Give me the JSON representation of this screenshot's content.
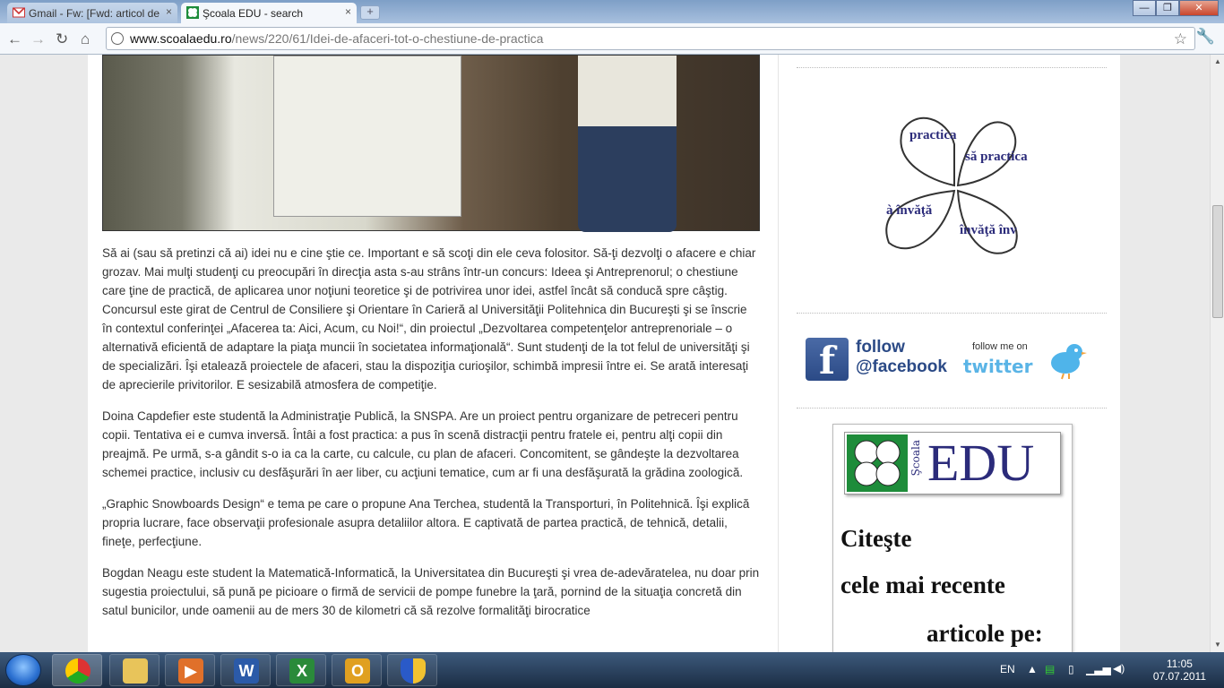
{
  "browser": {
    "tabs": [
      {
        "title": "Gmail - Fw: [Fwd: articol de",
        "active": false
      },
      {
        "title": "Şcoala EDU - search",
        "active": true
      }
    ],
    "close_tab": "×",
    "new_tab": "+",
    "url_host": "www.scoalaedu.ro",
    "url_path": "/news/220/61/Idei-de-afaceri-tot-o-chestiune-de-practica"
  },
  "article": {
    "paragraphs": [
      "Să ai (sau să pretinzi că ai) idei nu e cine ştie ce. Important e să scoţi din ele ceva folositor. Să-ţi dezvolţi o afacere e chiar grozav. Mai mulţi studenţi cu preocupări în direcţia asta s-au strâns într-un concurs: Ideea şi Antreprenorul; o chestiune care ţine de practică, de aplicarea unor noţiuni teoretice şi de potrivirea unor idei, astfel încât să conducă spre câştig. Concursul este girat de Centrul de Consiliere şi Orientare în Carieră al Universităţii Politehnica din Bucureşti şi se înscrie în contextul conferinţei „Afacerea ta: Aici, Acum, cu Noi!“, din proiectul „Dezvoltarea competenţelor antreprenoriale – o alternativă eficientă de adaptare la piaţa muncii în societatea informaţională“. Sunt studenţi de la tot felul de universităţi şi de specializări. Îşi etalează proiectele de afaceri, stau la dispoziţia curioşilor, schimbă impresii între ei. Se arată interesaţi de aprecierile privitorilor. E sesizabilă atmosfera de competiţie.",
      "Doina Capdefier este studentă la Administraţie Publică, la SNSPA. Are un proiect pentru organizare de petreceri pentru copii. Tentativa ei e cumva inversă. Întâi a fost practica: a pus în scenă distracţii pentru fratele ei, pentru alţi copii din preajmă. Pe urmă, s-a gândit s-o ia ca la carte, cu calcule, cu plan de afaceri. Concomitent, se gândeşte la dezvoltarea schemei practice, inclusiv cu desfăşurări în aer liber, cu acţiuni tematice, cum ar fi una desfăşurată la grădina zoologică.",
      "„Graphic Snowboards Design“ e tema pe care o propune Ana Terchea, studentă la Transporturi, în Politehnică. Îşi explică propria lucrare, face observaţii profesionale asupra detaliilor altora. E captivată de partea practică, de tehnică, detalii, fineţe, perfecţiune.",
      "Bogdan Neagu este student la Matematică-Informatică, la Universitatea din Bucureşti şi vrea de-adevăratelea, nu doar prin sugestia proiectului, să pună pe picioare o firmă de servicii de pompe funebre la ţară, pornind de la situaţia concretă din satul bunicilor, unde oamenii au de mers 30 de kilometri că să rezolve formalităţi birocratice"
    ]
  },
  "sidebar": {
    "clover_words": [
      "practica",
      "să practica",
      "à învăţă",
      "învăţă înv"
    ],
    "facebook_follow": "follow",
    "facebook_handle": "@facebook",
    "twitter_follow": "follow me on",
    "twitter_logo": "twitter",
    "edu_banner_small": "Şcoala",
    "edu_banner_big": "EDU",
    "cta_line1": "Citeşte",
    "cta_line2": "cele mai recente",
    "cta_line3": "articole pe:"
  },
  "taskbar": {
    "language": "EN",
    "time": "11:05",
    "date": "07.07.2011",
    "apps": [
      "chrome",
      "explorer",
      "media-player",
      "word",
      "excel",
      "outlook",
      "security"
    ]
  }
}
